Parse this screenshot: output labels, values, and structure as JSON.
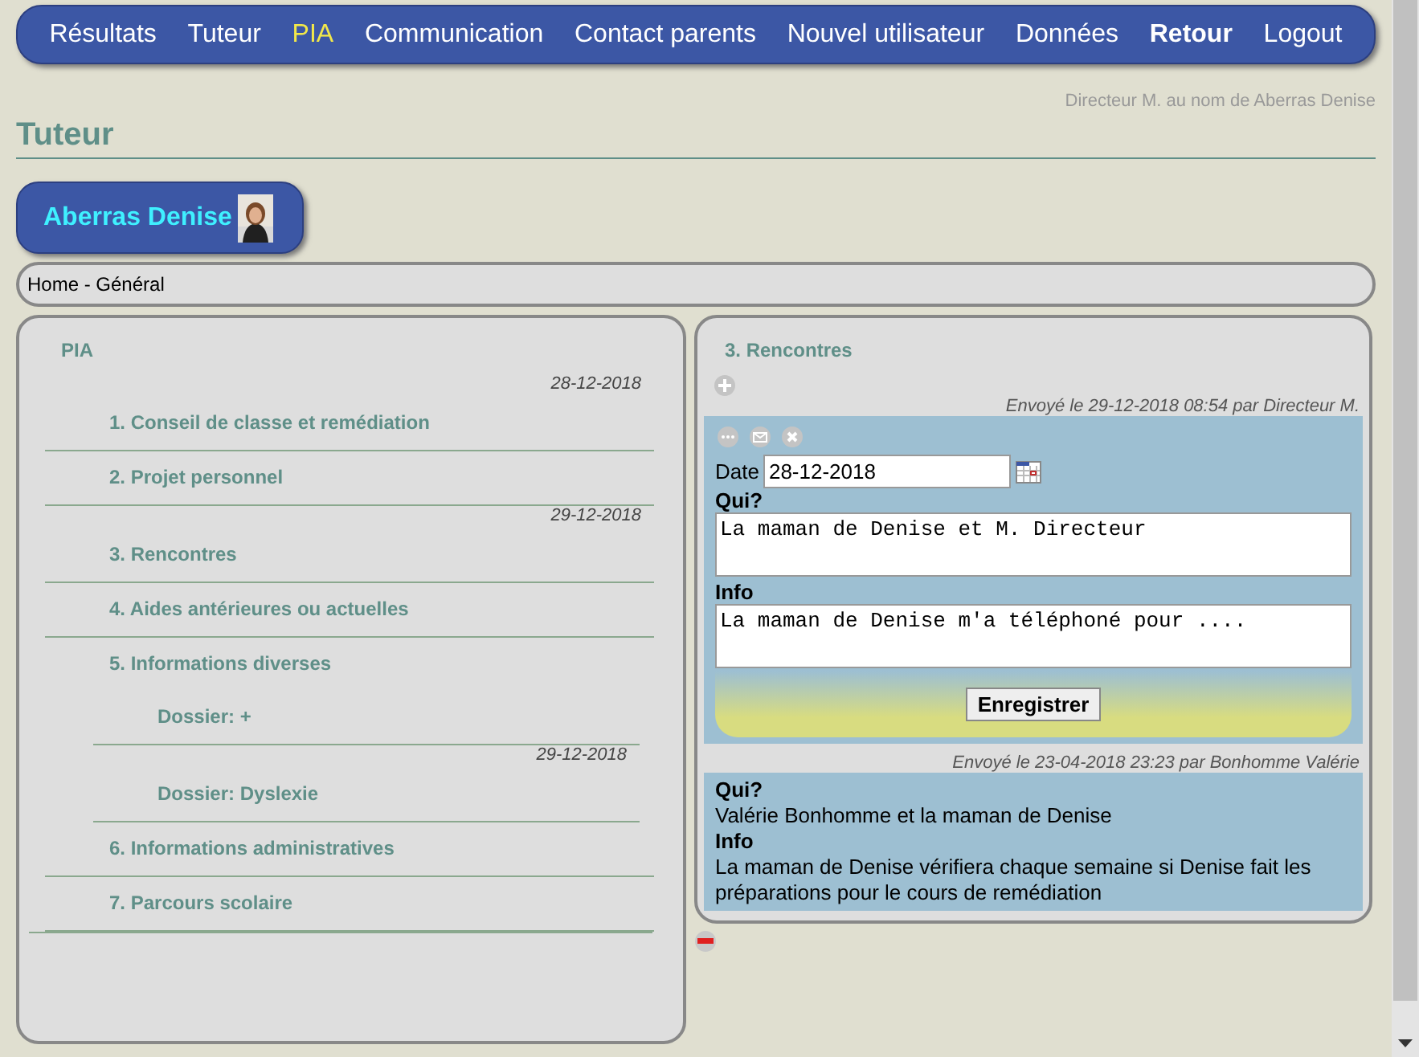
{
  "nav": [
    {
      "label": "Résultats",
      "selected": false,
      "emphasis": false
    },
    {
      "label": "Tuteur",
      "selected": false,
      "emphasis": false
    },
    {
      "label": "PIA",
      "selected": true,
      "emphasis": false
    },
    {
      "label": "Communication",
      "selected": false,
      "emphasis": false
    },
    {
      "label": "Contact parents",
      "selected": false,
      "emphasis": false
    },
    {
      "label": "Nouvel utilisateur",
      "selected": false,
      "emphasis": false
    },
    {
      "label": "Données",
      "selected": false,
      "emphasis": false
    },
    {
      "label": "Retour",
      "selected": false,
      "emphasis": true
    },
    {
      "label": "Logout",
      "selected": false,
      "emphasis": false
    }
  ],
  "user_line": "Directeur M. au nom de Aberras Denise",
  "page_title": "Tuteur",
  "student": {
    "name": "Aberras Denise"
  },
  "breadcrumb": "Home - Général",
  "outline": {
    "title": "PIA",
    "items": [
      {
        "date": "28-12-2018",
        "label": "1. Conseil de classe et remédiation"
      },
      {
        "label": "2. Projet personnel"
      },
      {
        "date": "29-12-2018",
        "label": "3. Rencontres"
      },
      {
        "label": "4. Aides antérieures ou actuelles"
      },
      {
        "label": "5. Informations diverses",
        "children": [
          {
            "label": "Dossier: +"
          },
          {
            "date": "29-12-2018",
            "label": "Dossier: Dyslexie"
          }
        ]
      },
      {
        "label": "6. Informations administratives"
      },
      {
        "label": "7. Parcours scolaire"
      }
    ]
  },
  "meetings": {
    "title": "3. Rencontres",
    "draft": {
      "sent": "Envoyé le 29-12-2018 08:54 par Directeur M.",
      "date_label": "Date",
      "date": "28-12-2018",
      "who_label": "Qui?",
      "who": "La maman de Denise et M. Directeur",
      "info_label": "Info",
      "info": "La maman de Denise m'a téléphoné pour ....",
      "save": "Enregistrer"
    },
    "entries": [
      {
        "sent": "Envoyé le 23-04-2018 23:23 par Bonhomme Valérie",
        "who_label": "Qui?",
        "who": "Valérie Bonhomme et la maman de Denise",
        "info_label": "Info",
        "info": "La maman de Denise vérifiera chaque semaine si Denise fait les préparations pour le cours de remédiation"
      }
    ]
  }
}
